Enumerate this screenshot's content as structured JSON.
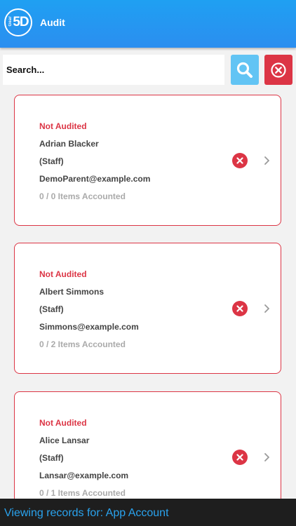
{
  "header": {
    "logo_small": "Gear",
    "logo_main": "5D",
    "title": "Audit"
  },
  "search": {
    "placeholder": "Search...",
    "value": ""
  },
  "icons": {
    "search": "search-icon",
    "clear": "close-circle-icon",
    "status": "close-icon",
    "chevron": "chevron-right-icon"
  },
  "colors": {
    "header": "#2196f3",
    "accent_red": "#dc3545",
    "search_button": "#62c4f4",
    "footer_text": "#2aa3ee"
  },
  "records": [
    {
      "status": "Not Audited",
      "name": "Adrian Blacker",
      "role": "(Staff)",
      "email": "DemoParent@example.com",
      "items": "0 / 0 Items Accounted"
    },
    {
      "status": "Not Audited",
      "name": "Albert Simmons",
      "role": "(Staff)",
      "email": "Simmons@example.com",
      "items": "0 / 2 Items Accounted"
    },
    {
      "status": "Not Audited",
      "name": "Alice Lansar",
      "role": "(Staff)",
      "email": "Lansar@example.com",
      "items": "0 / 1 Items Accounted"
    }
  ],
  "footer": {
    "text": "Viewing records for: App Account"
  }
}
